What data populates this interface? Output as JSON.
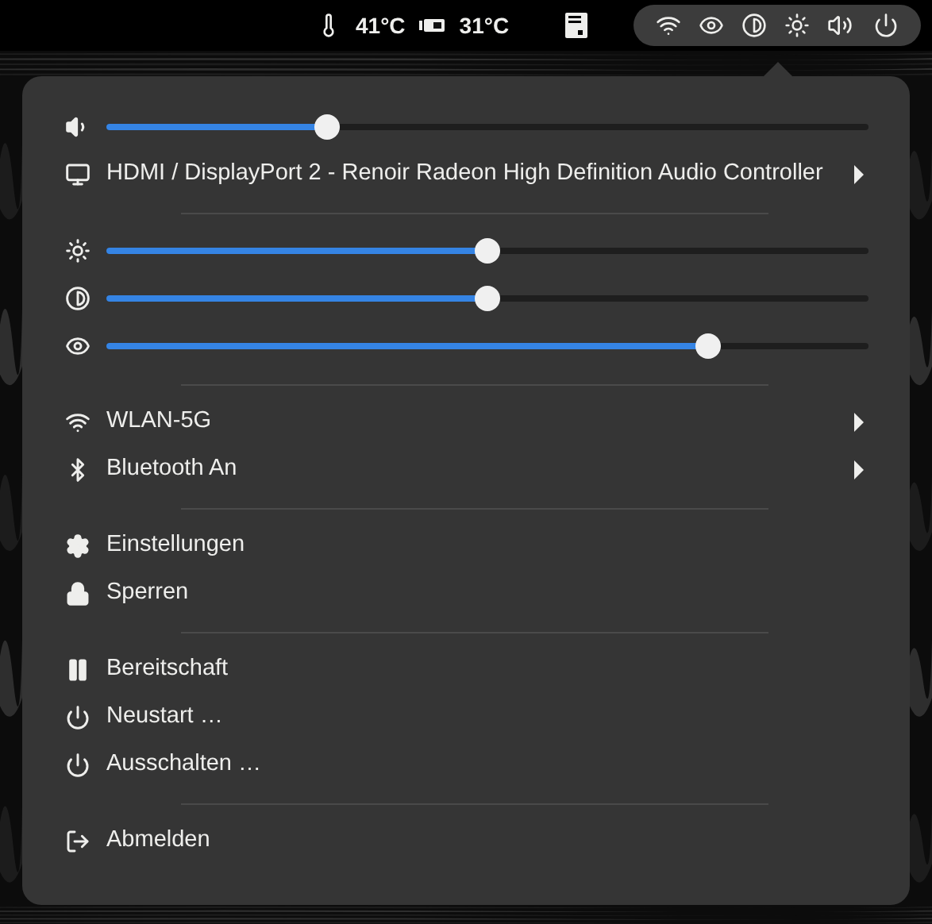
{
  "top_bar": {
    "sensors": [
      {
        "reading": "41°C"
      },
      {
        "reading": "31°C"
      }
    ]
  },
  "menu": {
    "sections": [
      {
        "items": [
          {
            "kind": "slider",
            "level": 0.29
          },
          {
            "kind": "row",
            "label": "HDMI / DisplayPort 2 - Renoir Radeon High Definition Audio Controller",
            "submenu": true
          }
        ]
      },
      {
        "items": [
          {
            "kind": "slider",
            "level": 0.5
          },
          {
            "kind": "slider",
            "level": 0.5
          },
          {
            "kind": "slider",
            "level": 0.79
          }
        ]
      },
      {
        "items": [
          {
            "kind": "row",
            "label": "WLAN-5G",
            "submenu": true
          },
          {
            "kind": "row",
            "label": "Bluetooth An",
            "submenu": true
          }
        ]
      },
      {
        "items": [
          {
            "kind": "row",
            "label": "Einstellungen",
            "submenu": false
          },
          {
            "kind": "row",
            "label": "Sperren",
            "submenu": false
          }
        ]
      },
      {
        "items": [
          {
            "kind": "row",
            "label": "Bereitschaft",
            "submenu": false
          },
          {
            "kind": "row",
            "label": "Neustart …",
            "submenu": false
          },
          {
            "kind": "row",
            "label": "Ausschalten …",
            "submenu": false
          }
        ]
      },
      {
        "items": [
          {
            "kind": "row",
            "label": "Abmelden",
            "submenu": false
          }
        ]
      }
    ]
  }
}
